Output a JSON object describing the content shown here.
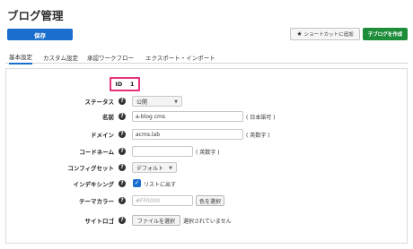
{
  "header": {
    "title": "ブログ管理",
    "save_label": "保存",
    "shortcut_label": "ショートカットに追加",
    "add_child_label": "子ブログを作成"
  },
  "tabs": [
    {
      "label": "基本設定",
      "active": true
    },
    {
      "label": "カスタム設定",
      "active": false
    },
    {
      "label": "承認ワークフロー",
      "active": false
    },
    {
      "label": "エクスポート・インポート",
      "active": false
    }
  ],
  "form": {
    "id": {
      "label": "ID",
      "value": "1"
    },
    "status": {
      "label": "ステータス",
      "value": "公開"
    },
    "name": {
      "label": "名前",
      "value": "a-blog cms",
      "hint": "( 日本語可 )"
    },
    "domain": {
      "label": "ドメイン",
      "value": "acms.lab",
      "hint": "( 英数字 )"
    },
    "code": {
      "label": "コードネーム",
      "value": "",
      "hint": "( 英数字 )"
    },
    "config_set": {
      "label": "コンフィグセット",
      "value": "デフォルト"
    },
    "indexing": {
      "label": "インデキシング",
      "checkbox_label": "リストに出す",
      "checked": true
    },
    "theme_color": {
      "label": "テーマカラー",
      "placeholder": "#FF0000",
      "button_label": "色を選択"
    },
    "site_logo": {
      "label": "サイトロゴ",
      "button_label": "ファイルを選択",
      "status": "選択されていません"
    }
  },
  "colors": {
    "primary": "#1a6fce",
    "success": "#1e8d3a",
    "highlight": "#e8317b"
  },
  "icons": {
    "help": "help-icon",
    "star": "star-icon",
    "caret": "caret-down-icon",
    "check": "check-icon"
  }
}
